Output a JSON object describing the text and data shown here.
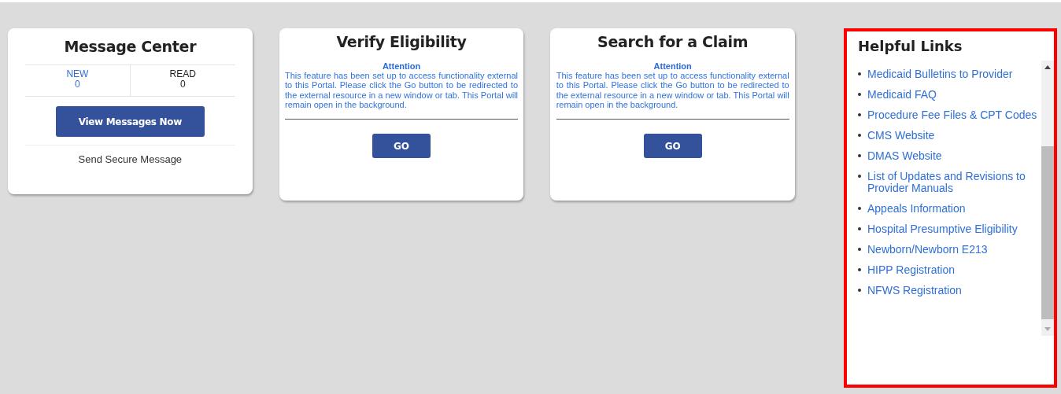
{
  "message_center": {
    "title": "Message Center",
    "counts": [
      {
        "label": "NEW",
        "value": "0",
        "kind": "new"
      },
      {
        "label": "READ",
        "value": "0",
        "kind": "read"
      }
    ],
    "button": "View Messages Now",
    "link": "Send Secure Message"
  },
  "cards": [
    {
      "title": "Verify Eligibility",
      "notice_title": "Attention",
      "notice": "This feature has been set up to access functionality external to this Portal. Please click the Go button to be redirected to the external resource in a new window or tab. This Portal will remain open in the background.",
      "button": "GO"
    },
    {
      "title": "Search for a Claim",
      "notice_title": "Attention",
      "notice": "This feature has been set up to access functionality external to this Portal. Please click the Go button to be redirected to the external resource in a new window or tab. This Portal will remain open in the background.",
      "button": "GO"
    }
  ],
  "helpful_links": {
    "title": "Helpful Links",
    "links": [
      "Medicaid Bulletins to Provider",
      "Medicaid FAQ",
      "Procedure Fee Files & CPT Codes",
      "CMS Website",
      "DMAS Website",
      "List of Updates and Revisions to Provider Manuals",
      "Appeals Information",
      "Hospital Presumptive Eligibility",
      "Newborn/Newborn E213",
      "HIPP Registration",
      "NFWS Registration"
    ]
  }
}
